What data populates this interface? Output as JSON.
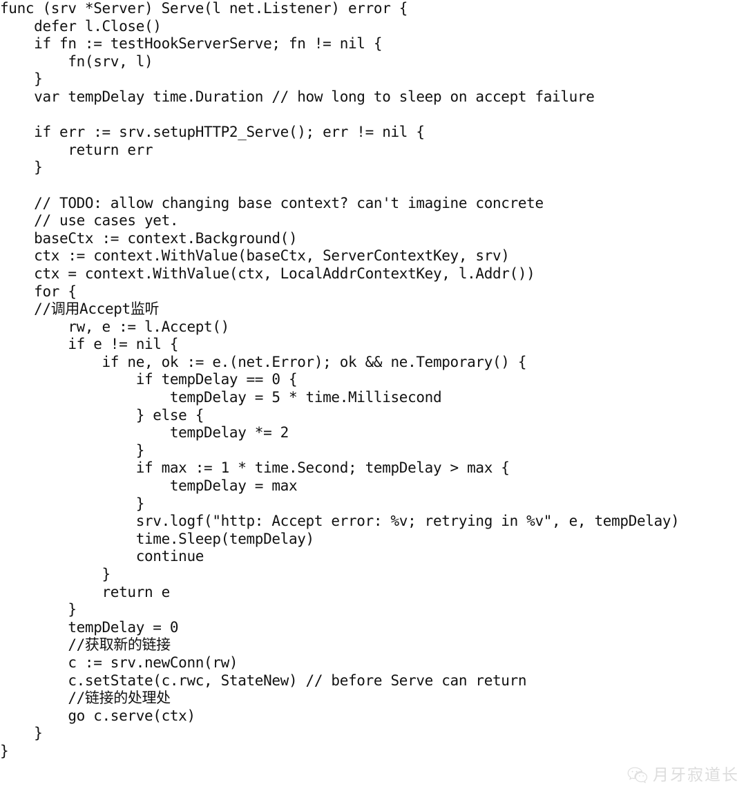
{
  "document": {
    "kind": "code-screenshot",
    "language": "Go",
    "background_color": "#ffffff",
    "text_color": "#111111",
    "code_lines": [
      "func (srv *Server) Serve(l net.Listener) error {",
      "    defer l.Close()",
      "    if fn := testHookServerServe; fn != nil {",
      "        fn(srv, l)",
      "    }",
      "    var tempDelay time.Duration // how long to sleep on accept failure",
      "",
      "    if err := srv.setupHTTP2_Serve(); err != nil {",
      "        return err",
      "    }",
      "",
      "    // TODO: allow changing base context? can't imagine concrete",
      "    // use cases yet.",
      "    baseCtx := context.Background()",
      "    ctx := context.WithValue(baseCtx, ServerContextKey, srv)",
      "    ctx = context.WithValue(ctx, LocalAddrContextKey, l.Addr())",
      "    for {",
      "    //调用Accept监听",
      "        rw, e := l.Accept()",
      "        if e != nil {",
      "            if ne, ok := e.(net.Error); ok && ne.Temporary() {",
      "                if tempDelay == 0 {",
      "                    tempDelay = 5 * time.Millisecond",
      "                } else {",
      "                    tempDelay *= 2",
      "                }",
      "                if max := 1 * time.Second; tempDelay > max {",
      "                    tempDelay = max",
      "                }",
      "                srv.logf(\"http: Accept error: %v; retrying in %v\", e, tempDelay)",
      "                time.Sleep(tempDelay)",
      "                continue",
      "            }",
      "            return e",
      "        }",
      "        tempDelay = 0",
      "        //获取新的链接",
      "        c := srv.newConn(rw)",
      "        c.setState(c.rwc, StateNew) // before Serve can return",
      "        //链接的处理处",
      "        go c.serve(ctx)",
      "    }",
      "}"
    ]
  },
  "watermark": {
    "icon": "wechat-icon",
    "text": "月牙寂道长",
    "color": "#8d8d8d"
  }
}
